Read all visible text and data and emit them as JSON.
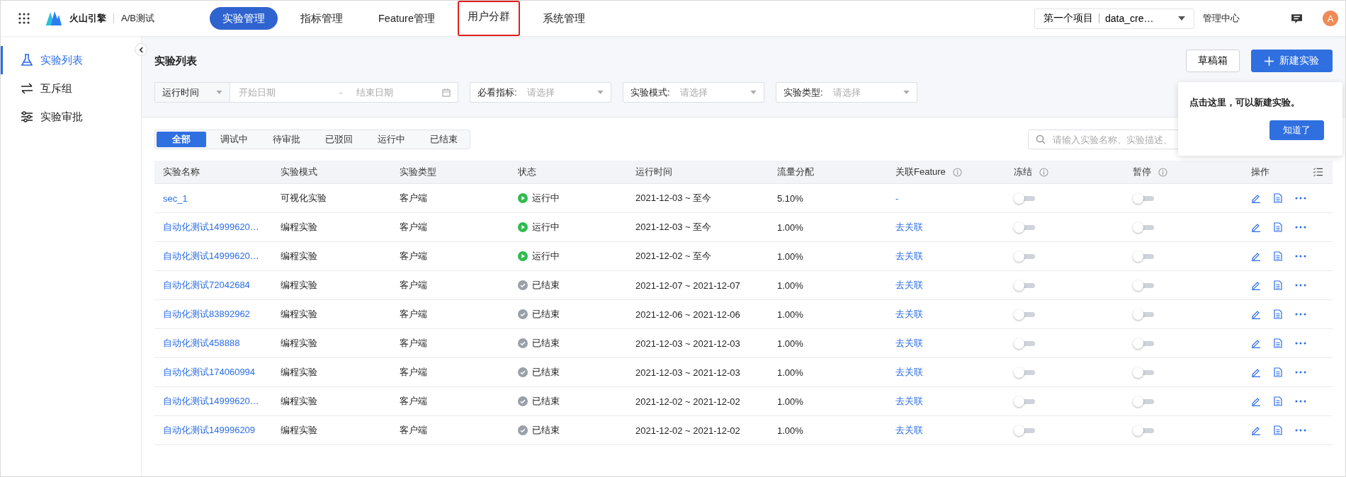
{
  "header": {
    "app_name": "火山引擎",
    "product": "A/B测试",
    "nav": [
      {
        "label": "实验管理",
        "selected": true,
        "highlighted": false
      },
      {
        "label": "指标管理",
        "selected": false,
        "highlighted": false
      },
      {
        "label": "Feature管理",
        "selected": false,
        "highlighted": false
      },
      {
        "label": "用户分群",
        "selected": false,
        "highlighted": true
      },
      {
        "label": "系统管理",
        "selected": false,
        "highlighted": false
      }
    ],
    "project": {
      "name": "第一个项目",
      "app": "data_cre…"
    },
    "admin_link": "管理中心",
    "avatar": "A"
  },
  "sidebar": {
    "items": [
      {
        "label": "实验列表",
        "selected": true
      },
      {
        "label": "互斥组",
        "selected": false
      },
      {
        "label": "实验审批",
        "selected": false
      }
    ]
  },
  "page": {
    "title": "实验列表",
    "drafts_button": "草稿箱",
    "new_button": "新建实验"
  },
  "filters": {
    "time": {
      "label": "运行时间",
      "start_placeholder": "开始日期",
      "separator": "-",
      "end_placeholder": "结束日期"
    },
    "selects": [
      {
        "label": "必看指标:",
        "placeholder": "请选择"
      },
      {
        "label": "实验模式:",
        "placeholder": "请选择"
      },
      {
        "label": "实验类型:",
        "placeholder": "请选择"
      }
    ]
  },
  "status_tabs": [
    {
      "label": "全部",
      "selected": true
    },
    {
      "label": "调试中",
      "selected": false
    },
    {
      "label": "待审批",
      "selected": false
    },
    {
      "label": "已驳回",
      "selected": false
    },
    {
      "label": "运行中",
      "selected": false
    },
    {
      "label": "已结束",
      "selected": false
    }
  ],
  "search": {
    "placeholder": "请输入实验名称、实验描述、"
  },
  "tooltip": {
    "text": "点击这里，可以新建实验。",
    "button": "知道了"
  },
  "table": {
    "columns": [
      {
        "label": "实验名称",
        "info": false
      },
      {
        "label": "实验模式",
        "info": false
      },
      {
        "label": "实验类型",
        "info": false
      },
      {
        "label": "状态",
        "info": false
      },
      {
        "label": "运行时间",
        "info": false
      },
      {
        "label": "流量分配",
        "info": false
      },
      {
        "label": "关联Feature",
        "info": true
      },
      {
        "label": "冻结",
        "info": true
      },
      {
        "label": "暂停",
        "info": true
      },
      {
        "label": "操作",
        "info": false
      }
    ],
    "rows": [
      {
        "name": "sec_1",
        "mode": "可视化实验",
        "type": "客户端",
        "status": {
          "kind": "running",
          "label": "运行中"
        },
        "time": "2021-12-03 ~ 至今",
        "traffic": "5.10%",
        "feature": "-",
        "frozen": false,
        "paused": false
      },
      {
        "name": "自动化测试14999620…",
        "mode": "编程实验",
        "type": "客户端",
        "status": {
          "kind": "running",
          "label": "运行中"
        },
        "time": "2021-12-03 ~ 至今",
        "traffic": "1.00%",
        "feature": "去关联",
        "frozen": false,
        "paused": false
      },
      {
        "name": "自动化测试14999620…",
        "mode": "编程实验",
        "type": "客户端",
        "status": {
          "kind": "running",
          "label": "运行中"
        },
        "time": "2021-12-02 ~ 至今",
        "traffic": "1.00%",
        "feature": "去关联",
        "frozen": false,
        "paused": false
      },
      {
        "name": "自动化测试72042684",
        "mode": "编程实验",
        "type": "客户端",
        "status": {
          "kind": "ended",
          "label": "已结束"
        },
        "time": "2021-12-07 ~ 2021-12-07",
        "traffic": "1.00%",
        "feature": "去关联",
        "frozen": false,
        "paused": false
      },
      {
        "name": "自动化测试83892962",
        "mode": "编程实验",
        "type": "客户端",
        "status": {
          "kind": "ended",
          "label": "已结束"
        },
        "time": "2021-12-06 ~ 2021-12-06",
        "traffic": "1.00%",
        "feature": "去关联",
        "frozen": false,
        "paused": false
      },
      {
        "name": "自动化测试458888",
        "mode": "编程实验",
        "type": "客户端",
        "status": {
          "kind": "ended",
          "label": "已结束"
        },
        "time": "2021-12-03 ~ 2021-12-03",
        "traffic": "1.00%",
        "feature": "去关联",
        "frozen": false,
        "paused": false
      },
      {
        "name": "自动化测试174060994",
        "mode": "编程实验",
        "type": "客户端",
        "status": {
          "kind": "ended",
          "label": "已结束"
        },
        "time": "2021-12-03 ~ 2021-12-03",
        "traffic": "1.00%",
        "feature": "去关联",
        "frozen": false,
        "paused": false
      },
      {
        "name": "自动化测试14999620…",
        "mode": "编程实验",
        "type": "客户端",
        "status": {
          "kind": "ended",
          "label": "已结束"
        },
        "time": "2021-12-02 ~ 2021-12-02",
        "traffic": "1.00%",
        "feature": "去关联",
        "frozen": false,
        "paused": false
      },
      {
        "name": "自动化测试149996209",
        "mode": "编程实验",
        "type": "客户端",
        "status": {
          "kind": "ended",
          "label": "已结束"
        },
        "time": "2021-12-02 ~ 2021-12-02",
        "traffic": "1.00%",
        "feature": "去关联",
        "frozen": false,
        "paused": false
      }
    ]
  }
}
